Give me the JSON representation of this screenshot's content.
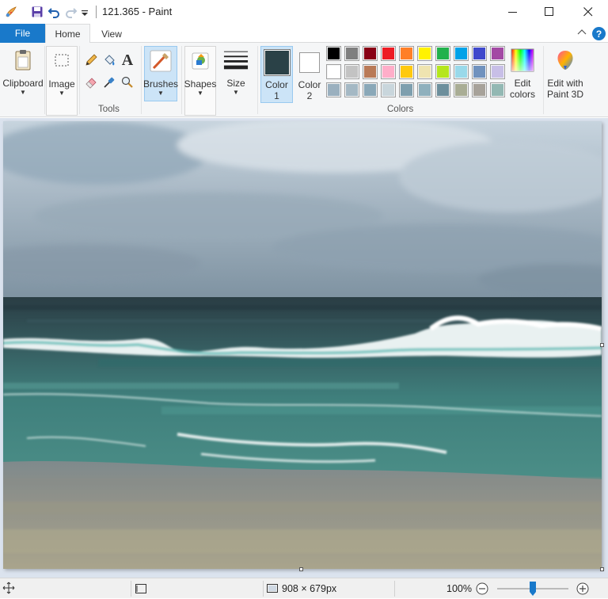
{
  "window": {
    "title": "121.365 - Paint"
  },
  "tabs": {
    "file": "File",
    "home": "Home",
    "view": "View"
  },
  "ribbon": {
    "clipboard": "Clipboard",
    "image": "Image",
    "tools_group": "Tools",
    "brushes": "Brushes",
    "shapes": "Shapes",
    "size": "Size",
    "color1_line1": "Color",
    "color1_line2": "1",
    "color2_line1": "Color",
    "color2_line2": "2",
    "colors_group": "Colors",
    "edit_colors_line1": "Edit",
    "edit_colors_line2": "colors",
    "paint3d_line1": "Edit with",
    "paint3d_line2": "Paint 3D",
    "text_tool_glyph": "A"
  },
  "colors": {
    "color1": "#2a4147",
    "color2": "#ffffff",
    "palette_row1": [
      "#000000",
      "#7f7f7f",
      "#880015",
      "#ed1c24",
      "#ff7f27",
      "#fff200",
      "#22b14c",
      "#00a2e8",
      "#3f48cc",
      "#a349a4"
    ],
    "palette_row2": [
      "#ffffff",
      "#c3c3c3",
      "#b97a57",
      "#ffaec9",
      "#ffc90e",
      "#efe4b0",
      "#b5e61d",
      "#99d9ea",
      "#7092be",
      "#c8bfe7"
    ],
    "palette_row3": [
      "#9ab0bf",
      "#a4b8c4",
      "#8aa8b8",
      "#c9d6dc",
      "#7e9fae",
      "#8fb0bd",
      "#6d8f9c",
      "#a9ad95",
      "#a7a29a",
      "#93b8b3"
    ],
    "accent": "#1979ca"
  },
  "status": {
    "dimensions": "908 × 679px",
    "zoom": "100%",
    "zoom_level_fraction": 0.5
  }
}
